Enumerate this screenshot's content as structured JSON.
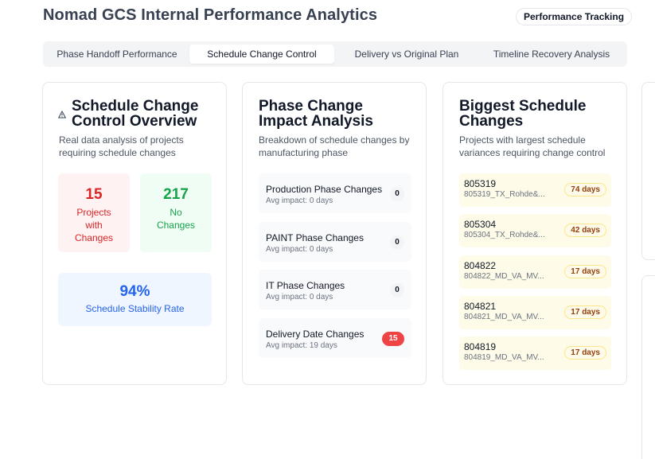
{
  "header": {
    "title": "Nomad GCS Internal Performance Analytics",
    "badge": "Performance Tracking"
  },
  "tabs": [
    {
      "label": "Phase Handoff Performance",
      "active": false
    },
    {
      "label": "Schedule Change Control",
      "active": true
    },
    {
      "label": "Delivery vs Original Plan",
      "active": false
    },
    {
      "label": "Timeline Recovery Analysis",
      "active": false
    }
  ],
  "overview": {
    "title_line1": "Schedule Change",
    "title_line2": "Control Overview",
    "icon": "alert-triangle-icon",
    "desc_line1": "Real data analysis of projects",
    "desc_line2": "requiring schedule changes",
    "with_changes": {
      "value": "15",
      "label_line1": "Projects",
      "label_line2": "with",
      "label_line3": "Changes"
    },
    "no_changes": {
      "value": "217",
      "label_line1": "No",
      "label_line2": "Changes"
    },
    "stability": {
      "value": "94%",
      "label": "Schedule Stability Rate"
    }
  },
  "impact": {
    "title_line1": "Phase Change",
    "title_line2": "Impact Analysis",
    "desc_line1": "Breakdown of schedule changes by",
    "desc_line2": "manufacturing phase",
    "rows": [
      {
        "name": "Production Phase Changes",
        "sub": "Avg impact: 0 days",
        "count": "0"
      },
      {
        "name": "PAINT Phase Changes",
        "sub": "Avg impact: 0 days",
        "count": "0"
      },
      {
        "name": "IT Phase Changes",
        "sub": "Avg impact: 0 days",
        "count": "0"
      },
      {
        "name": "Delivery Date Changes",
        "sub": "Avg impact: 19 days",
        "count": "15"
      }
    ]
  },
  "biggest": {
    "title_line1": "Biggest Schedule",
    "title_line2": "Changes",
    "desc_line1": "Projects with largest schedule",
    "desc_line2": "variances requiring change control",
    "rows": [
      {
        "id": "805319",
        "sub": "805319_TX_Rohde&...",
        "days": "74 days"
      },
      {
        "id": "805304",
        "sub": "805304_TX_Rohde&...",
        "days": "42 days"
      },
      {
        "id": "804822",
        "sub": "804822_MD_VA_MV...",
        "days": "17 days"
      },
      {
        "id": "804821",
        "sub": "804821_MD_VA_MV...",
        "days": "17 days"
      },
      {
        "id": "804819",
        "sub": "804819_MD_VA_MV...",
        "days": "17 days"
      }
    ]
  },
  "colors": {
    "red_text": "#dc2626",
    "red_bg": "#fef2f2",
    "green_text": "#16a34a",
    "green_bg": "#f0fdf4",
    "blue_text": "#2563eb",
    "blue_bg": "#eff6ff"
  }
}
